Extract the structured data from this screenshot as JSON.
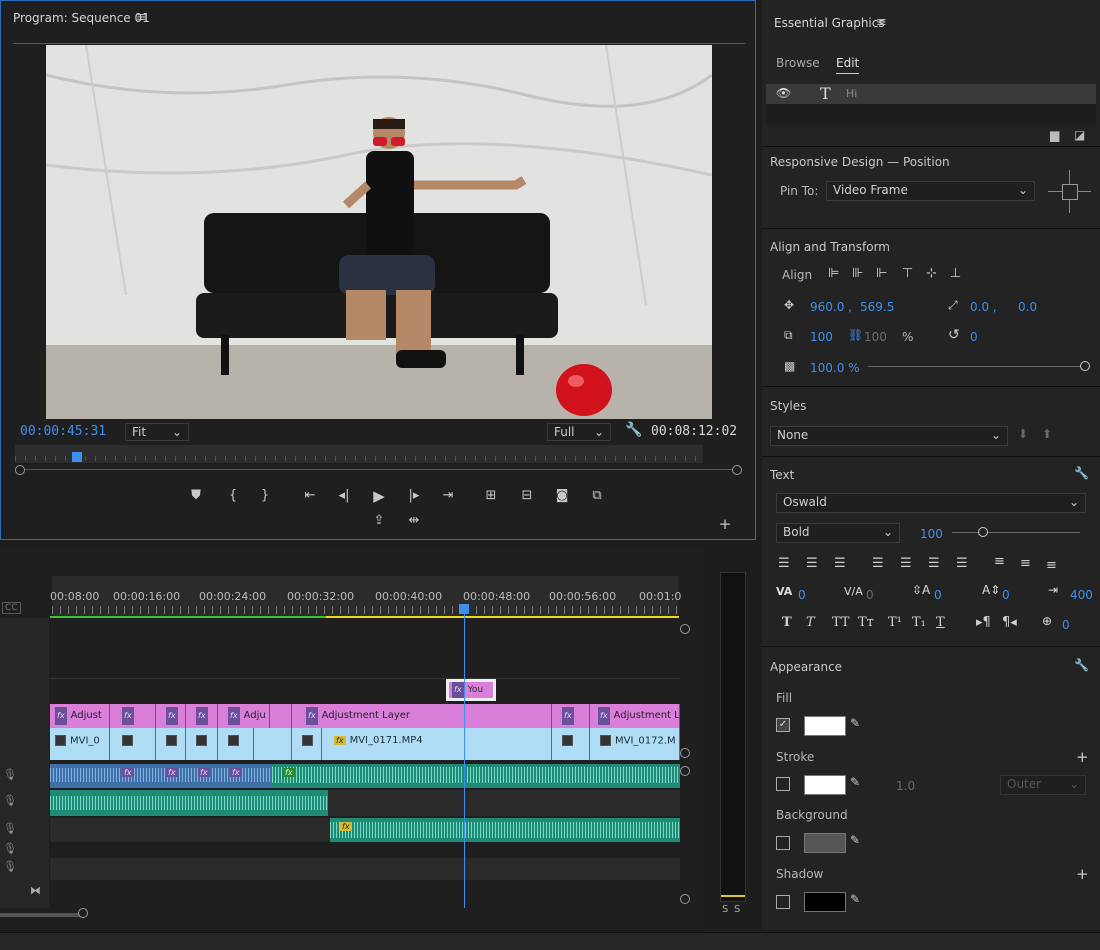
{
  "monitor": {
    "title": "Program: Sequence 01",
    "menu_icon": "hamburger-menu-icon",
    "timecode_current": "00:00:45:31",
    "timecode_duration": "00:08:12:02",
    "zoom": "Fit",
    "resolution": "Full",
    "playhead_progress": 0.09
  },
  "eg": {
    "title": "Essential Graphics",
    "tabs": [
      "Browse",
      "Edit"
    ],
    "layer_name": "Hi",
    "responsive_title": "Responsive Design — Position",
    "pin_label": "Pin To:",
    "pin_value": "Video Frame",
    "align_title": "Align and Transform",
    "align_label": "Align",
    "pos_x": "960.0 ,",
    "pos_y": "569.5",
    "anchor_x": "0.0 ,",
    "anchor_y": "0.0",
    "scale": "100",
    "scale_linked": "100",
    "pct": "%",
    "rotation": "0",
    "opacity": "100.0 %",
    "styles_title": "Styles",
    "style_value": "None",
    "text_title": "Text",
    "font": "Oswald",
    "weight": "Bold",
    "size": "100",
    "kerning": "0",
    "tracking": "0",
    "leading": "0",
    "baseline": "0",
    "tabwidth": "400",
    "tsume": "0",
    "appearance_title": "Appearance",
    "fill_label": "Fill",
    "stroke_label": "Stroke",
    "stroke_width": "1.0",
    "stroke_type": "Outer",
    "background_label": "Background",
    "shadow_label": "Shadow",
    "colors": {
      "fill": "#ffffff",
      "stroke": "#ffffff",
      "background": "#555555",
      "shadow": "#000000",
      "accent": "#3d8ff2"
    }
  },
  "timeline": {
    "ruler": [
      "00:08:00",
      "00:00:16:00",
      "00:00:24:00",
      "00:00:32:00",
      "00:00:40:00",
      "00:00:48:00",
      "00:00:56:00",
      "00:01:0"
    ],
    "v3_clip": "You",
    "v2_clips": [
      "Adjust",
      "Adju",
      "Adjustment Layer",
      "Adjustment L"
    ],
    "v1_clips": [
      "MVI_0",
      "MVI_0171.MP4",
      "MVI_0172.M"
    ],
    "meter_labels": [
      "S",
      "S"
    ]
  }
}
